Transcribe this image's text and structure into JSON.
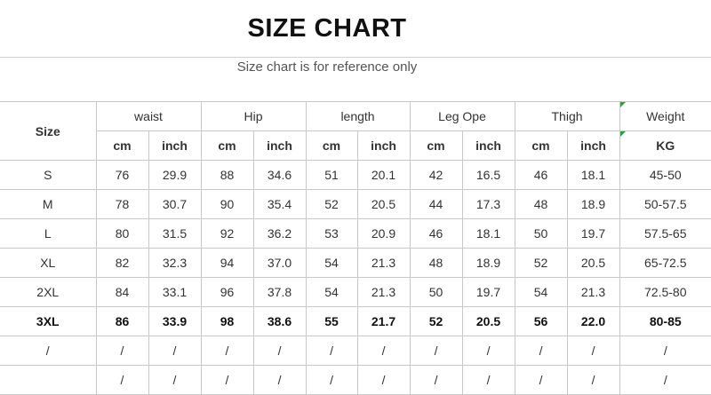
{
  "title": "SIZE CHART",
  "subtitle": "Size chart is for reference only",
  "table": {
    "size_header": "Size",
    "groups": [
      {
        "label": "waist",
        "units": [
          "cm",
          "inch"
        ]
      },
      {
        "label": "Hip",
        "units": [
          "cm",
          "inch"
        ]
      },
      {
        "label": "length",
        "units": [
          "cm",
          "inch"
        ]
      },
      {
        "label": "Leg Ope",
        "units": [
          "cm",
          "inch"
        ]
      },
      {
        "label": "Thigh",
        "units": [
          "cm",
          "inch"
        ]
      },
      {
        "label": "Weight",
        "units": [
          "KG"
        ]
      }
    ],
    "rows": [
      [
        "S",
        "76",
        "29.9",
        "88",
        "34.6",
        "51",
        "20.1",
        "42",
        "16.5",
        "46",
        "18.1",
        "45-50"
      ],
      [
        "M",
        "78",
        "30.7",
        "90",
        "35.4",
        "52",
        "20.5",
        "44",
        "17.3",
        "48",
        "18.9",
        "50-57.5"
      ],
      [
        "L",
        "80",
        "31.5",
        "92",
        "36.2",
        "53",
        "20.9",
        "46",
        "18.1",
        "50",
        "19.7",
        "57.5-65"
      ],
      [
        "XL",
        "82",
        "32.3",
        "94",
        "37.0",
        "54",
        "21.3",
        "48",
        "18.9",
        "52",
        "20.5",
        "65-72.5"
      ],
      [
        "2XL",
        "84",
        "33.1",
        "96",
        "37.8",
        "54",
        "21.3",
        "50",
        "19.7",
        "54",
        "21.3",
        "72.5-80"
      ],
      [
        "3XL",
        "86",
        "33.9",
        "98",
        "38.6",
        "55",
        "21.7",
        "52",
        "20.5",
        "56",
        "22.0",
        "80-85"
      ],
      [
        "/",
        "/",
        "/",
        "/",
        "/",
        "/",
        "/",
        "/",
        "/",
        "/",
        "/",
        "/"
      ],
      [
        "",
        "/",
        "/",
        "/",
        "/",
        "/",
        "/",
        "/",
        "/",
        "/",
        "/",
        "/"
      ]
    ],
    "bold_row": 5
  },
  "colors": {
    "cell_marker": "#2e9e3e",
    "grid": "#c8c8c8"
  }
}
